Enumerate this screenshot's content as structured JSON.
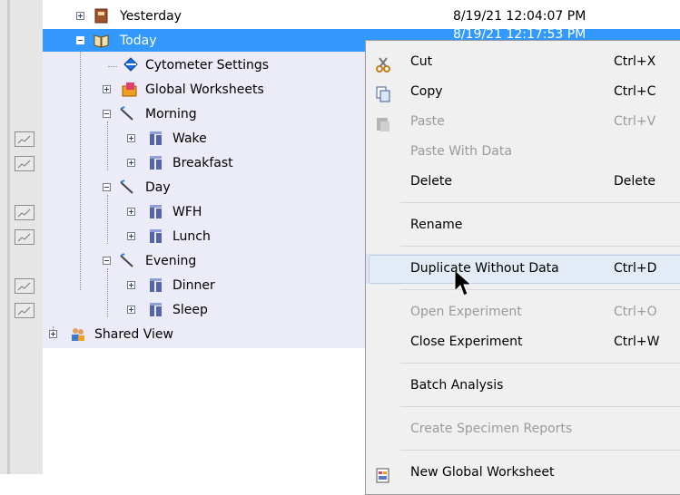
{
  "tree": {
    "items": [
      {
        "label": "Yesterday",
        "date": "8/19/21 12:04:07 PM"
      },
      {
        "label": "Today",
        "date": "8/19/21 12:17:53 PM"
      },
      {
        "label": "Cytometer Settings"
      },
      {
        "label": "Global Worksheets"
      },
      {
        "label": "Morning"
      },
      {
        "label": "Wake"
      },
      {
        "label": "Breakfast"
      },
      {
        "label": "Day"
      },
      {
        "label": "WFH"
      },
      {
        "label": "Lunch"
      },
      {
        "label": "Evening"
      },
      {
        "label": "Dinner"
      },
      {
        "label": "Sleep"
      },
      {
        "label": "Shared View"
      }
    ]
  },
  "context_menu": {
    "items": [
      {
        "label": "Cut",
        "shortcut": "Ctrl+X",
        "enabled": true,
        "icon": "scissors-icon"
      },
      {
        "label": "Copy",
        "shortcut": "Ctrl+C",
        "enabled": true,
        "icon": "copy-icon"
      },
      {
        "label": "Paste",
        "shortcut": "Ctrl+V",
        "enabled": false,
        "icon": "paste-icon"
      },
      {
        "label": "Paste With Data",
        "shortcut": "",
        "enabled": false
      },
      {
        "label": "Delete",
        "shortcut": "Delete",
        "enabled": true
      },
      {
        "label": "Rename",
        "shortcut": "",
        "enabled": true
      },
      {
        "label": "Duplicate Without Data",
        "shortcut": "Ctrl+D",
        "enabled": true,
        "hovered": true
      },
      {
        "label": "Open Experiment",
        "shortcut": "Ctrl+O",
        "enabled": false
      },
      {
        "label": "Close Experiment",
        "shortcut": "Ctrl+W",
        "enabled": true
      },
      {
        "label": "Batch Analysis",
        "shortcut": "",
        "enabled": true
      },
      {
        "label": "Create Specimen Reports",
        "shortcut": "",
        "enabled": false
      },
      {
        "label": "New Global Worksheet",
        "shortcut": "",
        "enabled": true,
        "icon": "worksheet-icon"
      }
    ]
  },
  "colors": {
    "selection": "#3399ff",
    "experiment_highlight": "#ecebf8",
    "menu_bg": "#f0f0f0",
    "disabled_text": "#9a9a9a"
  }
}
